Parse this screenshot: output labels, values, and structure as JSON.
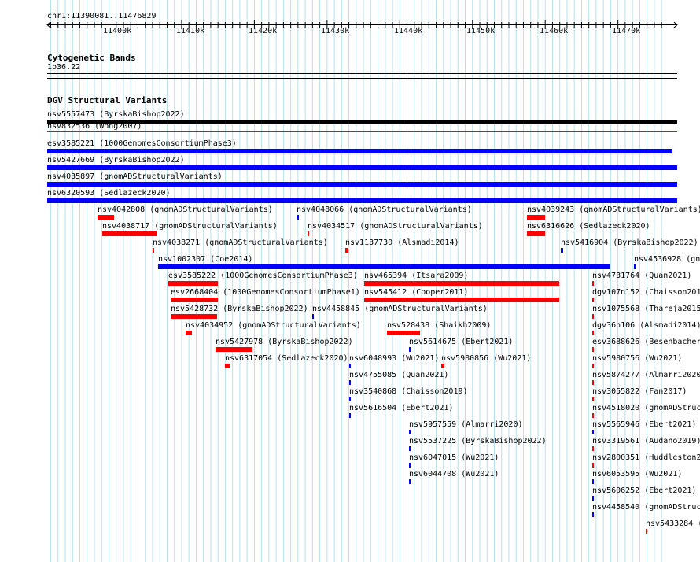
{
  "ruler": {
    "location": "chr1:11390081..11476829",
    "ticks": [
      "11400k",
      "11410k",
      "11420k",
      "11430k",
      "11440k",
      "11450k",
      "11460k",
      "11470k"
    ]
  },
  "cytogenetic": {
    "title": "Cytogenetic Bands",
    "band": "1p36.22"
  },
  "dgv": {
    "title": "DGV Structural Variants",
    "colors": {
      "loss": "#ff0000",
      "gain": "#0000ff",
      "both": "#000000"
    },
    "features": [
      {
        "id": "f1",
        "label": "nsv5557473 (ByrskaBishop2022)"
      },
      {
        "id": "f2",
        "label": "nsv832536 (Wong2007)"
      },
      {
        "id": "f3",
        "label": "esv3585221 (1000GenomesConsortiumPhase3)"
      },
      {
        "id": "f4",
        "label": "nsv5427669 (ByrskaBishop2022)"
      },
      {
        "id": "f5",
        "label": "nsv4035897 (gnomADStructuralVariants)"
      },
      {
        "id": "f6",
        "label": "nsv6320593 (Sedlazeck2020)"
      },
      {
        "id": "f7",
        "label": "nsv4042808 (gnomADStructuralVariants)"
      },
      {
        "id": "f8",
        "label": "nsv4048066 (gnomADStructuralVariants)"
      },
      {
        "id": "f9",
        "label": "nsv4039243 (gnomADStructuralVariants)"
      },
      {
        "id": "f10",
        "label": "nsv4038717 (gnomADStructuralVariants)"
      },
      {
        "id": "f11",
        "label": "nsv4034517 (gnomADStructuralVariants)"
      },
      {
        "id": "f12",
        "label": "nsv6316626 (Sedlazeck2020)"
      },
      {
        "id": "f13",
        "label": "nsv4038271 (gnomADStructuralVariants)"
      },
      {
        "id": "f14",
        "label": "nsv1137730 (Alsmadi2014)"
      },
      {
        "id": "f15",
        "label": "nsv5416904 (ByrskaBishop2022)"
      },
      {
        "id": "f16",
        "label": "nsv1002307 (Coe2014)"
      },
      {
        "id": "f17",
        "label": "nsv4536928 (gn"
      },
      {
        "id": "f18",
        "label": "esv3585222 (1000GenomesConsortiumPhase3)"
      },
      {
        "id": "f19",
        "label": "nsv465394 (Itsara2009)"
      },
      {
        "id": "f20",
        "label": "nsv4731764 (Quan2021)"
      },
      {
        "id": "f21",
        "label": "esv2668404 (1000GenomesConsortiumPhase1)"
      },
      {
        "id": "f22",
        "label": "nsv545412 (Cooper2011)"
      },
      {
        "id": "f23",
        "label": "dgv107n152 (Chaisson201"
      },
      {
        "id": "f24",
        "label": "nsv5428732 (ByrskaBishop2022)"
      },
      {
        "id": "f25",
        "label": "nsv4458845 (gnomADStructuralVariants)"
      },
      {
        "id": "f26",
        "label": "nsv1075568 (Thareja2015"
      },
      {
        "id": "f27",
        "label": "nsv4034952 (gnomADStructuralVariants)"
      },
      {
        "id": "f28",
        "label": "nsv528438 (Shaikh2009)"
      },
      {
        "id": "f29",
        "label": "dgv36n106 (Alsmadi2014)"
      },
      {
        "id": "f30",
        "label": "nsv5427978 (ByrskaBishop2022)"
      },
      {
        "id": "f31",
        "label": "nsv5614675 (Ebert2021)"
      },
      {
        "id": "f32",
        "label": "esv3688626 (Besenbacher"
      },
      {
        "id": "f33",
        "label": "nsv6317054 (Sedlazeck2020)"
      },
      {
        "id": "f34",
        "label": "nsv6048993 (Wu2021)"
      },
      {
        "id": "f35",
        "label": "nsv5980856 (Wu2021)"
      },
      {
        "id": "f36",
        "label": "nsv5980756 (Wu2021)"
      },
      {
        "id": "f37",
        "label": "nsv4755085 (Quan2021)"
      },
      {
        "id": "f38",
        "label": "nsv5874277 (Almarri2020"
      },
      {
        "id": "f39",
        "label": "nsv3540868 (Chaisson2019)"
      },
      {
        "id": "f40",
        "label": "nsv3055822 (Fan2017)"
      },
      {
        "id": "f41",
        "label": "nsv5616504 (Ebert2021)"
      },
      {
        "id": "f42",
        "label": "nsv4518020 (gnomADStruc"
      },
      {
        "id": "f43",
        "label": "nsv5957559 (Almarri2020)"
      },
      {
        "id": "f44",
        "label": "nsv5565946 (Ebert2021)"
      },
      {
        "id": "f45",
        "label": "nsv5537225 (ByrskaBishop2022)"
      },
      {
        "id": "f46",
        "label": "nsv3319561 (Audano2019)"
      },
      {
        "id": "f47",
        "label": "nsv6047015 (Wu2021)"
      },
      {
        "id": "f48",
        "label": "nsv2800351 (Huddleston2"
      },
      {
        "id": "f49",
        "label": "nsv6044708 (Wu2021)"
      },
      {
        "id": "f50",
        "label": "nsv6053595 (Wu2021)"
      },
      {
        "id": "f51",
        "label": "nsv5606252 (Ebert2021)"
      },
      {
        "id": "f52",
        "label": "nsv4458540 (gnomADStruc"
      },
      {
        "id": "f53",
        "label": "nsv5433284 ("
      }
    ]
  }
}
